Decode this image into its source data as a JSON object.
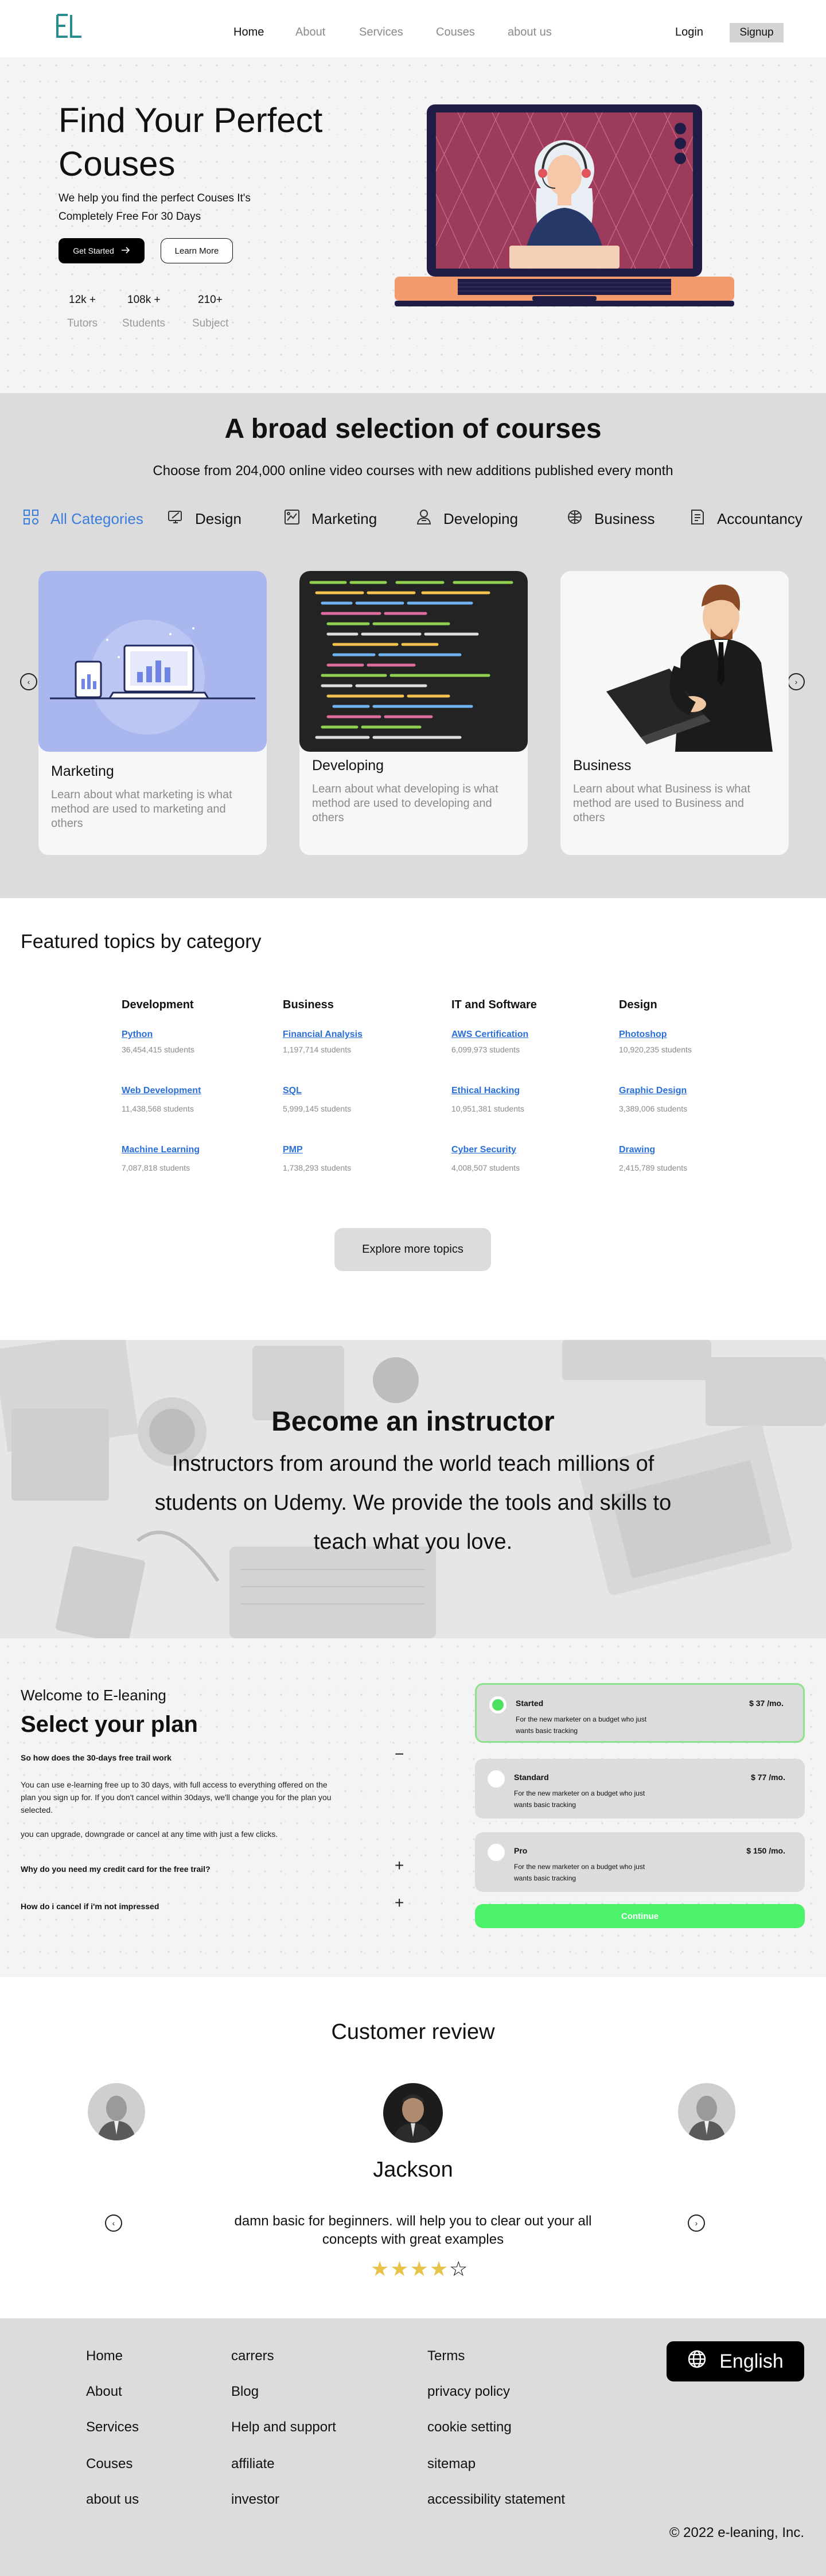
{
  "nav": {
    "links": [
      "Home",
      "About",
      "Services",
      "Couses",
      "about us"
    ],
    "login": "Login",
    "signup": "Signup"
  },
  "hero": {
    "title": "Find Your Perfect Couses",
    "subtitle": "We help you find the perfect Couses It's Completely Free For 30 Days",
    "get_started": "Get Started",
    "learn_more": "Learn More",
    "stats": [
      {
        "value": "12k +",
        "label": "Tutors"
      },
      {
        "value": "108k +",
        "label": "Students"
      },
      {
        "value": "210+",
        "label": "Subject"
      }
    ]
  },
  "courses": {
    "title": "A broad selection of courses",
    "subtitle": "Choose from 204,000 online video courses with new additions published every month",
    "categories": [
      "All Categories",
      "Design",
      "Marketing",
      "Developing",
      "Business",
      "Accountancy"
    ],
    "cards": [
      {
        "title": "Marketing",
        "desc": "Learn about what marketing is what method are used to marketing and others"
      },
      {
        "title": "Developing",
        "desc": "Learn about what developing is what method are used to developing and others"
      },
      {
        "title": "Business",
        "desc": "Learn about what Business is what method are used to Business and others"
      }
    ]
  },
  "featured": {
    "title": "Featured topics by category",
    "columns": [
      {
        "head": "Development",
        "topics": [
          {
            "name": "Python",
            "count": "36,454,415 students"
          },
          {
            "name": "Web Development",
            "count": "11,438,568 students"
          },
          {
            "name": "Machine Learning",
            "count": "7,087,818 students"
          }
        ]
      },
      {
        "head": "Business",
        "topics": [
          {
            "name": "Financial Analysis",
            "count": "1,197,714 students"
          },
          {
            "name": "SQL",
            "count": "5,999,145 students"
          },
          {
            "name": "PMP",
            "count": "1,738,293 students"
          }
        ]
      },
      {
        "head": "IT and Software",
        "topics": [
          {
            "name": "AWS Certification",
            "count": "6,099,973 students"
          },
          {
            "name": "Ethical Hacking",
            "count": "10,951,381 students"
          },
          {
            "name": "Cyber Security",
            "count": "4,008,507 students"
          }
        ]
      },
      {
        "head": "Design",
        "topics": [
          {
            "name": "Photoshop",
            "count": "10,920,235 students"
          },
          {
            "name": "Graphic Design",
            "count": "3,389,006 students"
          },
          {
            "name": "Drawing",
            "count": "2,415,789 students"
          }
        ]
      }
    ],
    "explore": "Explore more topics"
  },
  "instructor": {
    "title": "Become an instructor",
    "text": "Instructors from around the world teach millions of students on Udemy. We provide the tools and skills to teach what you love."
  },
  "plan": {
    "welcome": "Welcome to E-leaning",
    "title": "Select your plan",
    "faq": [
      {
        "q": "So how does  the 30-days free trail work",
        "icon": "−",
        "a1": "You can use e-learning free up to 30 days, with full access to everything offered on the plan you sign up for. If you don't cancel within 30days, we'll change you for the plan you selected.",
        "a2": "you can upgrade, downgrade or cancel at any time with just a few clicks."
      },
      {
        "q": "Why do you need my credit card for the free trail?",
        "icon": "+"
      },
      {
        "q": "How do i cancel if i'm not impressed",
        "icon": "+"
      }
    ],
    "options": [
      {
        "name": "Started",
        "desc": "For the new marketer on a budget who just wants basic tracking",
        "price": "$ 37 /mo.",
        "selected": true
      },
      {
        "name": "Standard",
        "desc": "For the new marketer on a budget who just wants basic tracking",
        "price": "$ 77 /mo.",
        "selected": false
      },
      {
        "name": "Pro",
        "desc": "For the new marketer on a budget who just wants basic tracking",
        "price": "$ 150 /mo.",
        "selected": false
      }
    ],
    "continue": "Continue"
  },
  "reviews": {
    "title": "Customer review",
    "name": "Jackson",
    "text": "damn basic for beginners. will help you to clear out your all concepts with great examples",
    "rating": 4,
    "rating_max": 5
  },
  "footer": {
    "col1": [
      "Home",
      "About",
      "Services",
      "Couses",
      "about us"
    ],
    "col2": [
      "carrers",
      "Blog",
      "Help and support",
      "affiliate",
      "investor"
    ],
    "col3": [
      "Terms",
      "privacy policy",
      "cookie setting",
      "sitemap",
      "accessibility statement"
    ],
    "language": "English",
    "copyright": "© 2022 e-leaning, Inc."
  },
  "colors": {
    "accent_blue": "#3b7ddd",
    "link_blue": "#2a6fd6",
    "plan_green": "#4cf26a",
    "star_gold": "#e8c34a"
  }
}
